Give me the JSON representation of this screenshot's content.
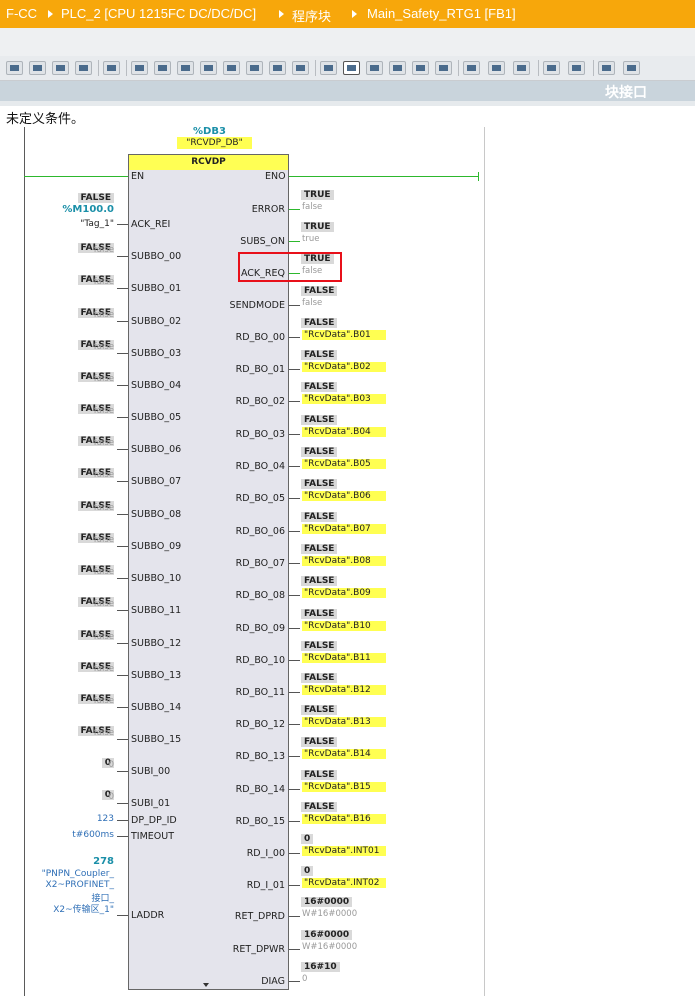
{
  "breadcrumb": [
    "F-CC",
    "PLC_2 [CPU 1215FC DC/DC/DC]",
    "程序块",
    "Main_Safety_RTG1 [FB1]"
  ],
  "toolbar": {
    "icons": [
      "network-icon",
      "delete-network-icon",
      "insert-network-icon",
      "remove-network-icon",
      "drag-icon",
      "align-icon",
      "pin-list-icon",
      "comment-icon",
      "display-absolute-icon",
      "open-all-icon",
      "close-all-icon",
      "addr-toggle-icon",
      "show-favorites-icon",
      "highlight-icon",
      "go-to-icon",
      "monitor-all-icon",
      "overview-icon",
      "watch-table-icon",
      "prev-error-icon",
      "next-error-icon",
      "branch-icon",
      "find-icon",
      "undo-icon",
      "redo-icon",
      "network-view-icon",
      "glasses-icon"
    ]
  },
  "interface_tab": "块接口",
  "condition_text": "未定义条件。",
  "instance": {
    "operand": "%DB3",
    "db_name": "\"RCVDP_DB\"",
    "block_type": "RCVDP"
  },
  "block": {
    "en": "EN",
    "eno": "ENO",
    "inputs": [
      {
        "pin": "ACK_REI",
        "tag": "%M100.0",
        "tag_name": "\"Tag_1\"",
        "status": "FALSE"
      },
      {
        "pin": "SUBBO_00",
        "status": "FALSE",
        "value": "false"
      },
      {
        "pin": "SUBBO_01",
        "status": "FALSE",
        "value": "false"
      },
      {
        "pin": "SUBBO_02",
        "status": "FALSE",
        "value": "false"
      },
      {
        "pin": "SUBBO_03",
        "status": "FALSE",
        "value": "false"
      },
      {
        "pin": "SUBBO_04",
        "status": "FALSE",
        "value": "false"
      },
      {
        "pin": "SUBBO_05",
        "status": "FALSE",
        "value": "false"
      },
      {
        "pin": "SUBBO_06",
        "status": "FALSE",
        "value": "false"
      },
      {
        "pin": "SUBBO_07",
        "status": "FALSE",
        "value": "false"
      },
      {
        "pin": "SUBBO_08",
        "status": "FALSE",
        "value": "false"
      },
      {
        "pin": "SUBBO_09",
        "status": "FALSE",
        "value": "false"
      },
      {
        "pin": "SUBBO_10",
        "status": "FALSE",
        "value": "false"
      },
      {
        "pin": "SUBBO_11",
        "status": "FALSE",
        "value": "false"
      },
      {
        "pin": "SUBBO_12",
        "status": "FALSE",
        "value": "false"
      },
      {
        "pin": "SUBBO_13",
        "status": "FALSE",
        "value": "false"
      },
      {
        "pin": "SUBBO_14",
        "status": "FALSE",
        "value": "false"
      },
      {
        "pin": "SUBBO_15",
        "status": "FALSE",
        "value": "false"
      },
      {
        "pin": "SUBI_00",
        "status": "0",
        "value": "0"
      },
      {
        "pin": "SUBI_01",
        "status": "0",
        "value": "0"
      },
      {
        "pin": "DP_DP_ID",
        "value": "123"
      },
      {
        "pin": "TIMEOUT",
        "value": "t#600ms"
      },
      {
        "pin": "LADDR",
        "status": "278",
        "value": "\"PNPN_Coupler_X2~PROFINET_接口_X2~传输区_1\"",
        "value_lines": [
          "\"PNPN_Coupler_",
          "X2~PROFINET_",
          "接口_",
          "X2~传输区_1\""
        ]
      }
    ],
    "outputs": [
      {
        "pin": "ERROR",
        "status": "TRUE",
        "value": "false"
      },
      {
        "pin": "SUBS_ON",
        "status": "TRUE",
        "value": "true"
      },
      {
        "pin": "ACK_REQ",
        "status": "TRUE",
        "value": "false"
      },
      {
        "pin": "SENDMODE",
        "status": "FALSE",
        "value": "false"
      },
      {
        "pin": "RD_BO_00",
        "status": "FALSE",
        "tag": "\"RcvData\".B01"
      },
      {
        "pin": "RD_BO_01",
        "status": "FALSE",
        "tag": "\"RcvData\".B02"
      },
      {
        "pin": "RD_BO_02",
        "status": "FALSE",
        "tag": "\"RcvData\".B03"
      },
      {
        "pin": "RD_BO_03",
        "status": "FALSE",
        "tag": "\"RcvData\".B04"
      },
      {
        "pin": "RD_BO_04",
        "status": "FALSE",
        "tag": "\"RcvData\".B05"
      },
      {
        "pin": "RD_BO_05",
        "status": "FALSE",
        "tag": "\"RcvData\".B06"
      },
      {
        "pin": "RD_BO_06",
        "status": "FALSE",
        "tag": "\"RcvData\".B07"
      },
      {
        "pin": "RD_BO_07",
        "status": "FALSE",
        "tag": "\"RcvData\".B08"
      },
      {
        "pin": "RD_BO_08",
        "status": "FALSE",
        "tag": "\"RcvData\".B09"
      },
      {
        "pin": "RD_BO_09",
        "status": "FALSE",
        "tag": "\"RcvData\".B10"
      },
      {
        "pin": "RD_BO_10",
        "status": "FALSE",
        "tag": "\"RcvData\".B11"
      },
      {
        "pin": "RD_BO_11",
        "status": "FALSE",
        "tag": "\"RcvData\".B12"
      },
      {
        "pin": "RD_BO_12",
        "status": "FALSE",
        "tag": "\"RcvData\".B13"
      },
      {
        "pin": "RD_BO_13",
        "status": "FALSE",
        "tag": "\"RcvData\".B14"
      },
      {
        "pin": "RD_BO_14",
        "status": "FALSE",
        "tag": "\"RcvData\".B15"
      },
      {
        "pin": "RD_BO_15",
        "status": "FALSE",
        "tag": "\"RcvData\".B16"
      },
      {
        "pin": "RD_I_00",
        "status": "0",
        "tag": "\"RcvData\".INT01"
      },
      {
        "pin": "RD_I_01",
        "status": "0",
        "tag": "\"RcvData\".INT02"
      },
      {
        "pin": "RET_DPRD",
        "status": "16#0000",
        "value": "W#16#0000"
      },
      {
        "pin": "RET_DPWR",
        "status": "16#0000",
        "value": "W#16#0000"
      },
      {
        "pin": "DIAG",
        "status": "16#10",
        "value": "0"
      }
    ]
  },
  "colors": {
    "breadcrumb_bg": "#f7a70b",
    "power_flow": "#2db82d",
    "highlight": "#e8101a",
    "tag_bg": "#ffff52",
    "operand": "#1a8fa8"
  }
}
